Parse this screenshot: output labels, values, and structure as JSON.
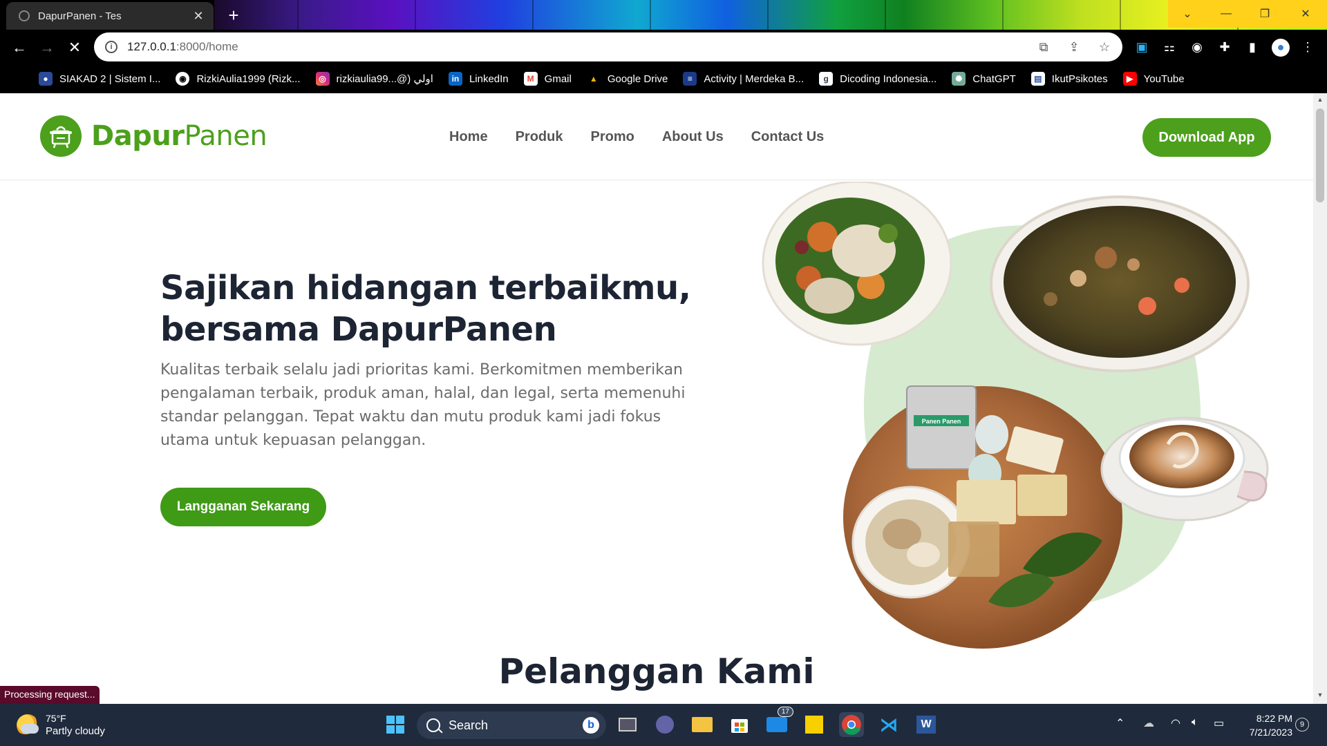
{
  "browser": {
    "tab_title": "DapurPanen - Tes",
    "url_host": "127.0.0.1",
    "url_path": ":8000/home",
    "bookmarks": [
      {
        "label": "SIAKAD 2 | Sistem I...",
        "icon": "siakad-icon",
        "color": "#2a4a9a"
      },
      {
        "label": "RizkiAulia1999 (Rizk...",
        "icon": "github-icon",
        "color": "#333333"
      },
      {
        "label": "rizkiaulia99...@) اولي",
        "icon": "instagram-icon",
        "color": "#d6249f"
      },
      {
        "label": "LinkedIn",
        "icon": "linkedin-icon",
        "color": "#0a66c2"
      },
      {
        "label": "Gmail",
        "icon": "gmail-icon",
        "color": "#ea4335"
      },
      {
        "label": "Google Drive",
        "icon": "google-drive-icon",
        "color": "#1fa463"
      },
      {
        "label": "Activity | Merdeka B...",
        "icon": "merdeka-icon",
        "color": "#1b3a8a"
      },
      {
        "label": "Dicoding Indonesia...",
        "icon": "dicoding-icon",
        "color": "#2d3e50"
      },
      {
        "label": "ChatGPT",
        "icon": "chatgpt-icon",
        "color": "#74aa9c"
      },
      {
        "label": "IkutPsikotes",
        "icon": "ikutpsikotes-icon",
        "color": "#3a5aa8"
      },
      {
        "label": "YouTube",
        "icon": "youtube-icon",
        "color": "#ff0000"
      }
    ],
    "status": "Processing request..."
  },
  "site": {
    "logo_bold": "Dapur",
    "logo_light": "Panen",
    "nav": [
      "Home",
      "Produk",
      "Promo",
      "About Us",
      "Contact Us"
    ],
    "download_label": "Download App",
    "hero_title": "Sajikan hidangan terbaikmu, bersama DapurPanen",
    "hero_desc": "Kualitas terbaik selalu jadi prioritas kami. Berkomitmen memberikan pengalaman terbaik, produk aman, halal, dan legal, serta memenuhi standar pelanggan. Tepat waktu dan mutu produk kami jadi fokus utama untuk kepuasan pelanggan.",
    "cta_label": "Langganan Sekarang",
    "section_title": "Pelanggan Kami",
    "package_label": "Panen Panen",
    "accent": "#4ca01c"
  },
  "taskbar": {
    "temp": "75°F",
    "condition": "Partly cloudy",
    "search_placeholder": "Search",
    "mail_badge": "17",
    "time": "8:22 PM",
    "date": "7/21/2023",
    "notifications": "9"
  }
}
